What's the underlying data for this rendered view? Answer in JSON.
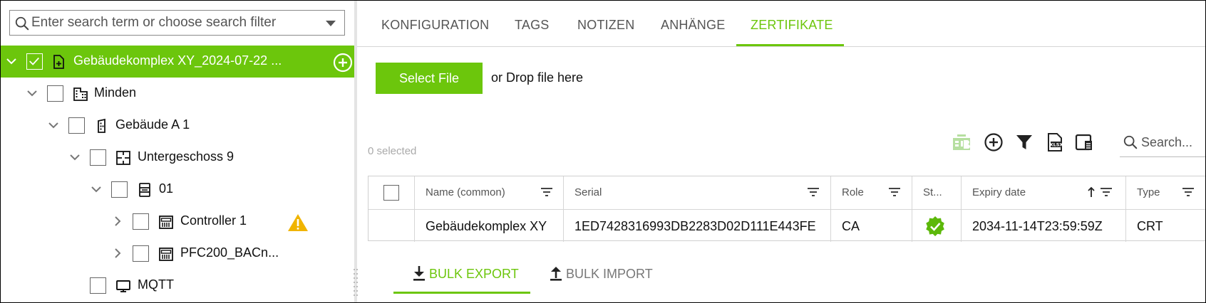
{
  "colors": {
    "accent": "#6cc60c",
    "warning": "#f0b400",
    "text": "#111111",
    "muted": "#555555"
  },
  "tree": {
    "search_placeholder": "Enter search term or choose search filter",
    "nodes": [
      {
        "label": "Gebäudekomplex XY_2024-07-22 ...",
        "icon": "file-plus-icon",
        "selected": true,
        "checked": true
      },
      {
        "label": "Minden",
        "icon": "city-icon"
      },
      {
        "label": "Gebäude A 1",
        "icon": "building-icon"
      },
      {
        "label": "Untergeschoss 9",
        "icon": "floor-plan-icon"
      },
      {
        "label": "01",
        "icon": "cabinet-icon"
      },
      {
        "label": "Controller 1",
        "icon": "controller-icon",
        "warning": true
      },
      {
        "label": "PFC200_BACn...",
        "icon": "controller-icon"
      },
      {
        "label": "MQTT",
        "icon": "monitor-icon"
      }
    ]
  },
  "tabs": [
    {
      "label": "KONFIGURATION"
    },
    {
      "label": "TAGS"
    },
    {
      "label": "NOTIZEN"
    },
    {
      "label": "ANHÄNGE"
    },
    {
      "label": "ZERTIFIKATE",
      "active": true
    }
  ],
  "upload": {
    "button_label": "Select File",
    "drop_text": "or Drop file here"
  },
  "toolbar": {
    "selected_count": "0 selected",
    "search_placeholder": "Search...",
    "icons": [
      "bulk-edit-icon",
      "add-circle-icon",
      "filter-icon",
      "export-excel-icon",
      "column-chooser-icon"
    ]
  },
  "table": {
    "columns": [
      "Name (common)",
      "Serial",
      "Role",
      "St...",
      "Expiry date",
      "Type"
    ],
    "sorted_column": "Expiry date",
    "sort_direction": "ascending",
    "rows": [
      {
        "name": "Gebäudekomplex XY",
        "serial": "1ED7428316993DB2283D02D111E443FE",
        "role": "CA",
        "status": "valid",
        "expiry": "2034-11-14T23:59:59Z",
        "type": "CRT"
      }
    ]
  },
  "bulk": {
    "export_label": "BULK EXPORT",
    "import_label": "BULK IMPORT"
  }
}
